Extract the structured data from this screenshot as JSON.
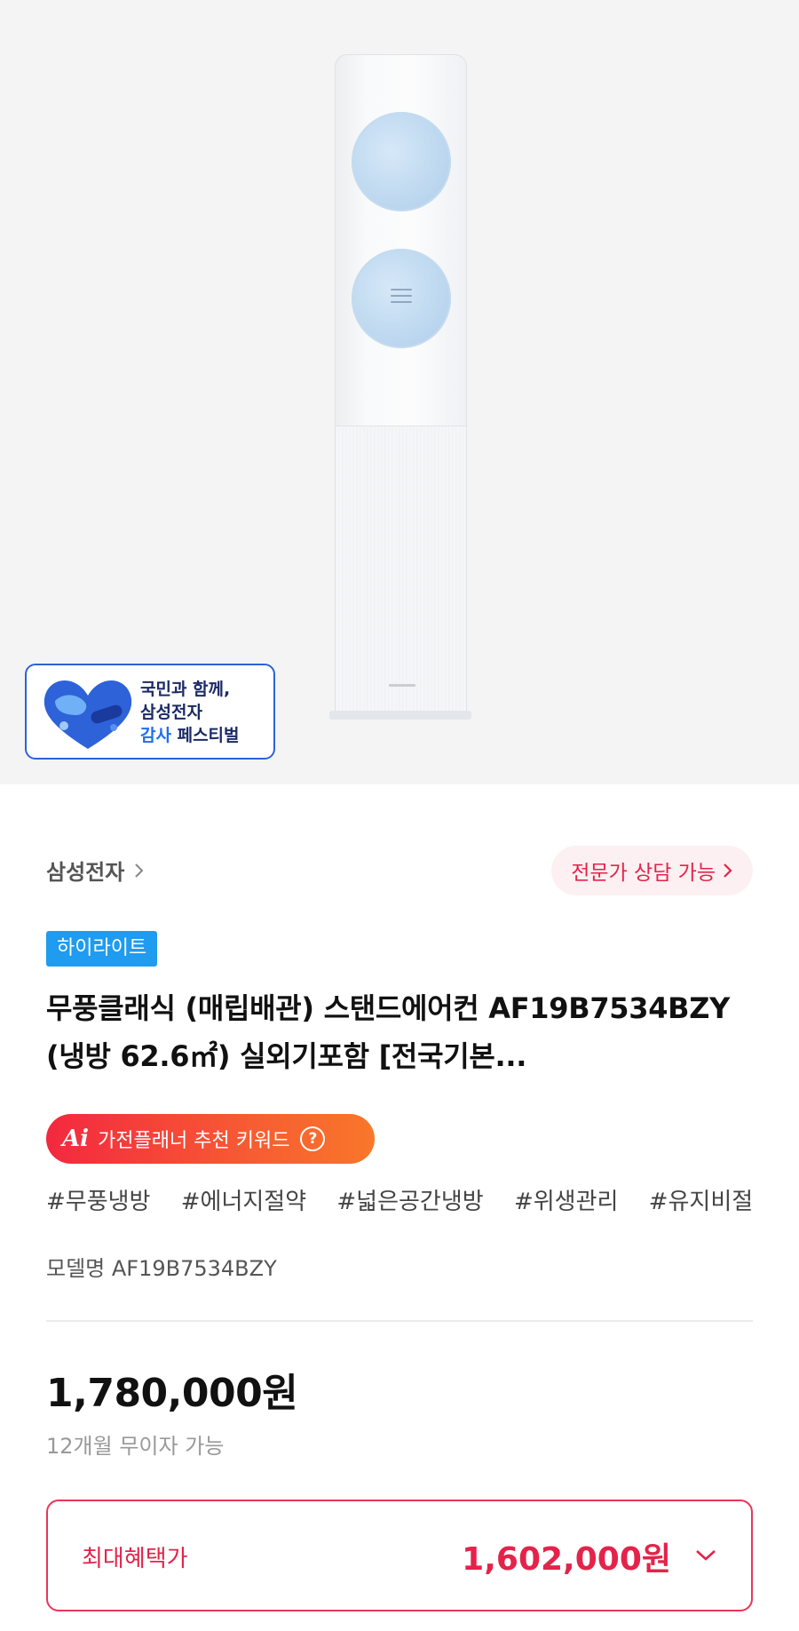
{
  "badge": {
    "line1": "국민과 함께,",
    "line2": "삼성전자",
    "line3_accent": "감사",
    "line3_rest": " 페스티벌"
  },
  "brand": {
    "name": "삼성전자"
  },
  "consult": {
    "label": "전문가 상담 가능"
  },
  "highlight": {
    "label": "하이라이트"
  },
  "product": {
    "title": "무풍클래식 (매립배관) 스탠드에어컨 AF19B7534BZY (냉방 62.6㎡) 실외기포함 [전국기본...",
    "model": "모델명 AF19B7534BZY"
  },
  "ai_keyword": {
    "logo": "Ai",
    "label": "가전플래너 추천 키워드",
    "help": "?"
  },
  "tags": [
    "#무풍냉방",
    "#에너지절약",
    "#넓은공간냉방",
    "#위생관리",
    "#유지비절"
  ],
  "pricing": {
    "price": "1,780,000원",
    "installment": "12개월 무이자 가능",
    "benefit_label": "최대혜택가",
    "benefit_price": "1,602,000원"
  },
  "colors": {
    "accent": "#e4234a",
    "highlight": "#1f9bf0",
    "ai_gradient_start": "#f3283f",
    "ai_gradient_end": "#f9772a"
  },
  "icons": [
    "chevron-right-icon",
    "heart-emblem-icon",
    "help-circle-icon",
    "chevron-down-icon"
  ]
}
